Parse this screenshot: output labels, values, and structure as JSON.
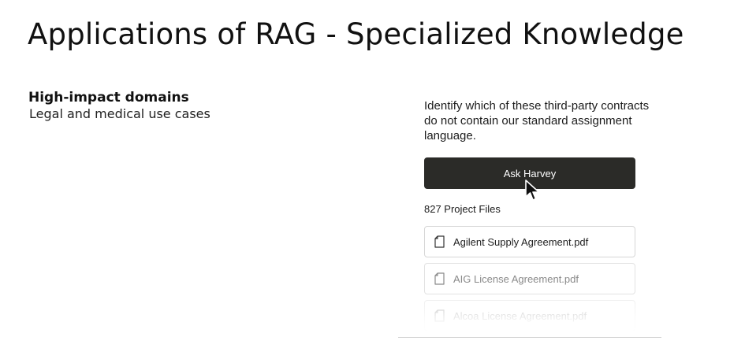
{
  "slide": {
    "title": "Applications of RAG - Specialized Knowledge"
  },
  "left": {
    "heading": "High-impact domains",
    "subheading": "Legal and medical use cases"
  },
  "panel": {
    "prompt": "Identify which of these third-party contracts do not contain our standard assignment language.",
    "button_label": "Ask Harvey",
    "files_count": "827 Project Files",
    "files": [
      {
        "name": "Agilent Supply Agreement.pdf",
        "icon": "document-icon"
      },
      {
        "name": "AIG License Agreement.pdf",
        "icon": "document-icon"
      },
      {
        "name": "Alcoa License Agreement.pdf",
        "icon": "document-icon"
      }
    ]
  },
  "colors": {
    "button_bg": "#2b2b28",
    "button_text": "#ffffff",
    "text": "#111111",
    "border": "#d6d6d6"
  }
}
